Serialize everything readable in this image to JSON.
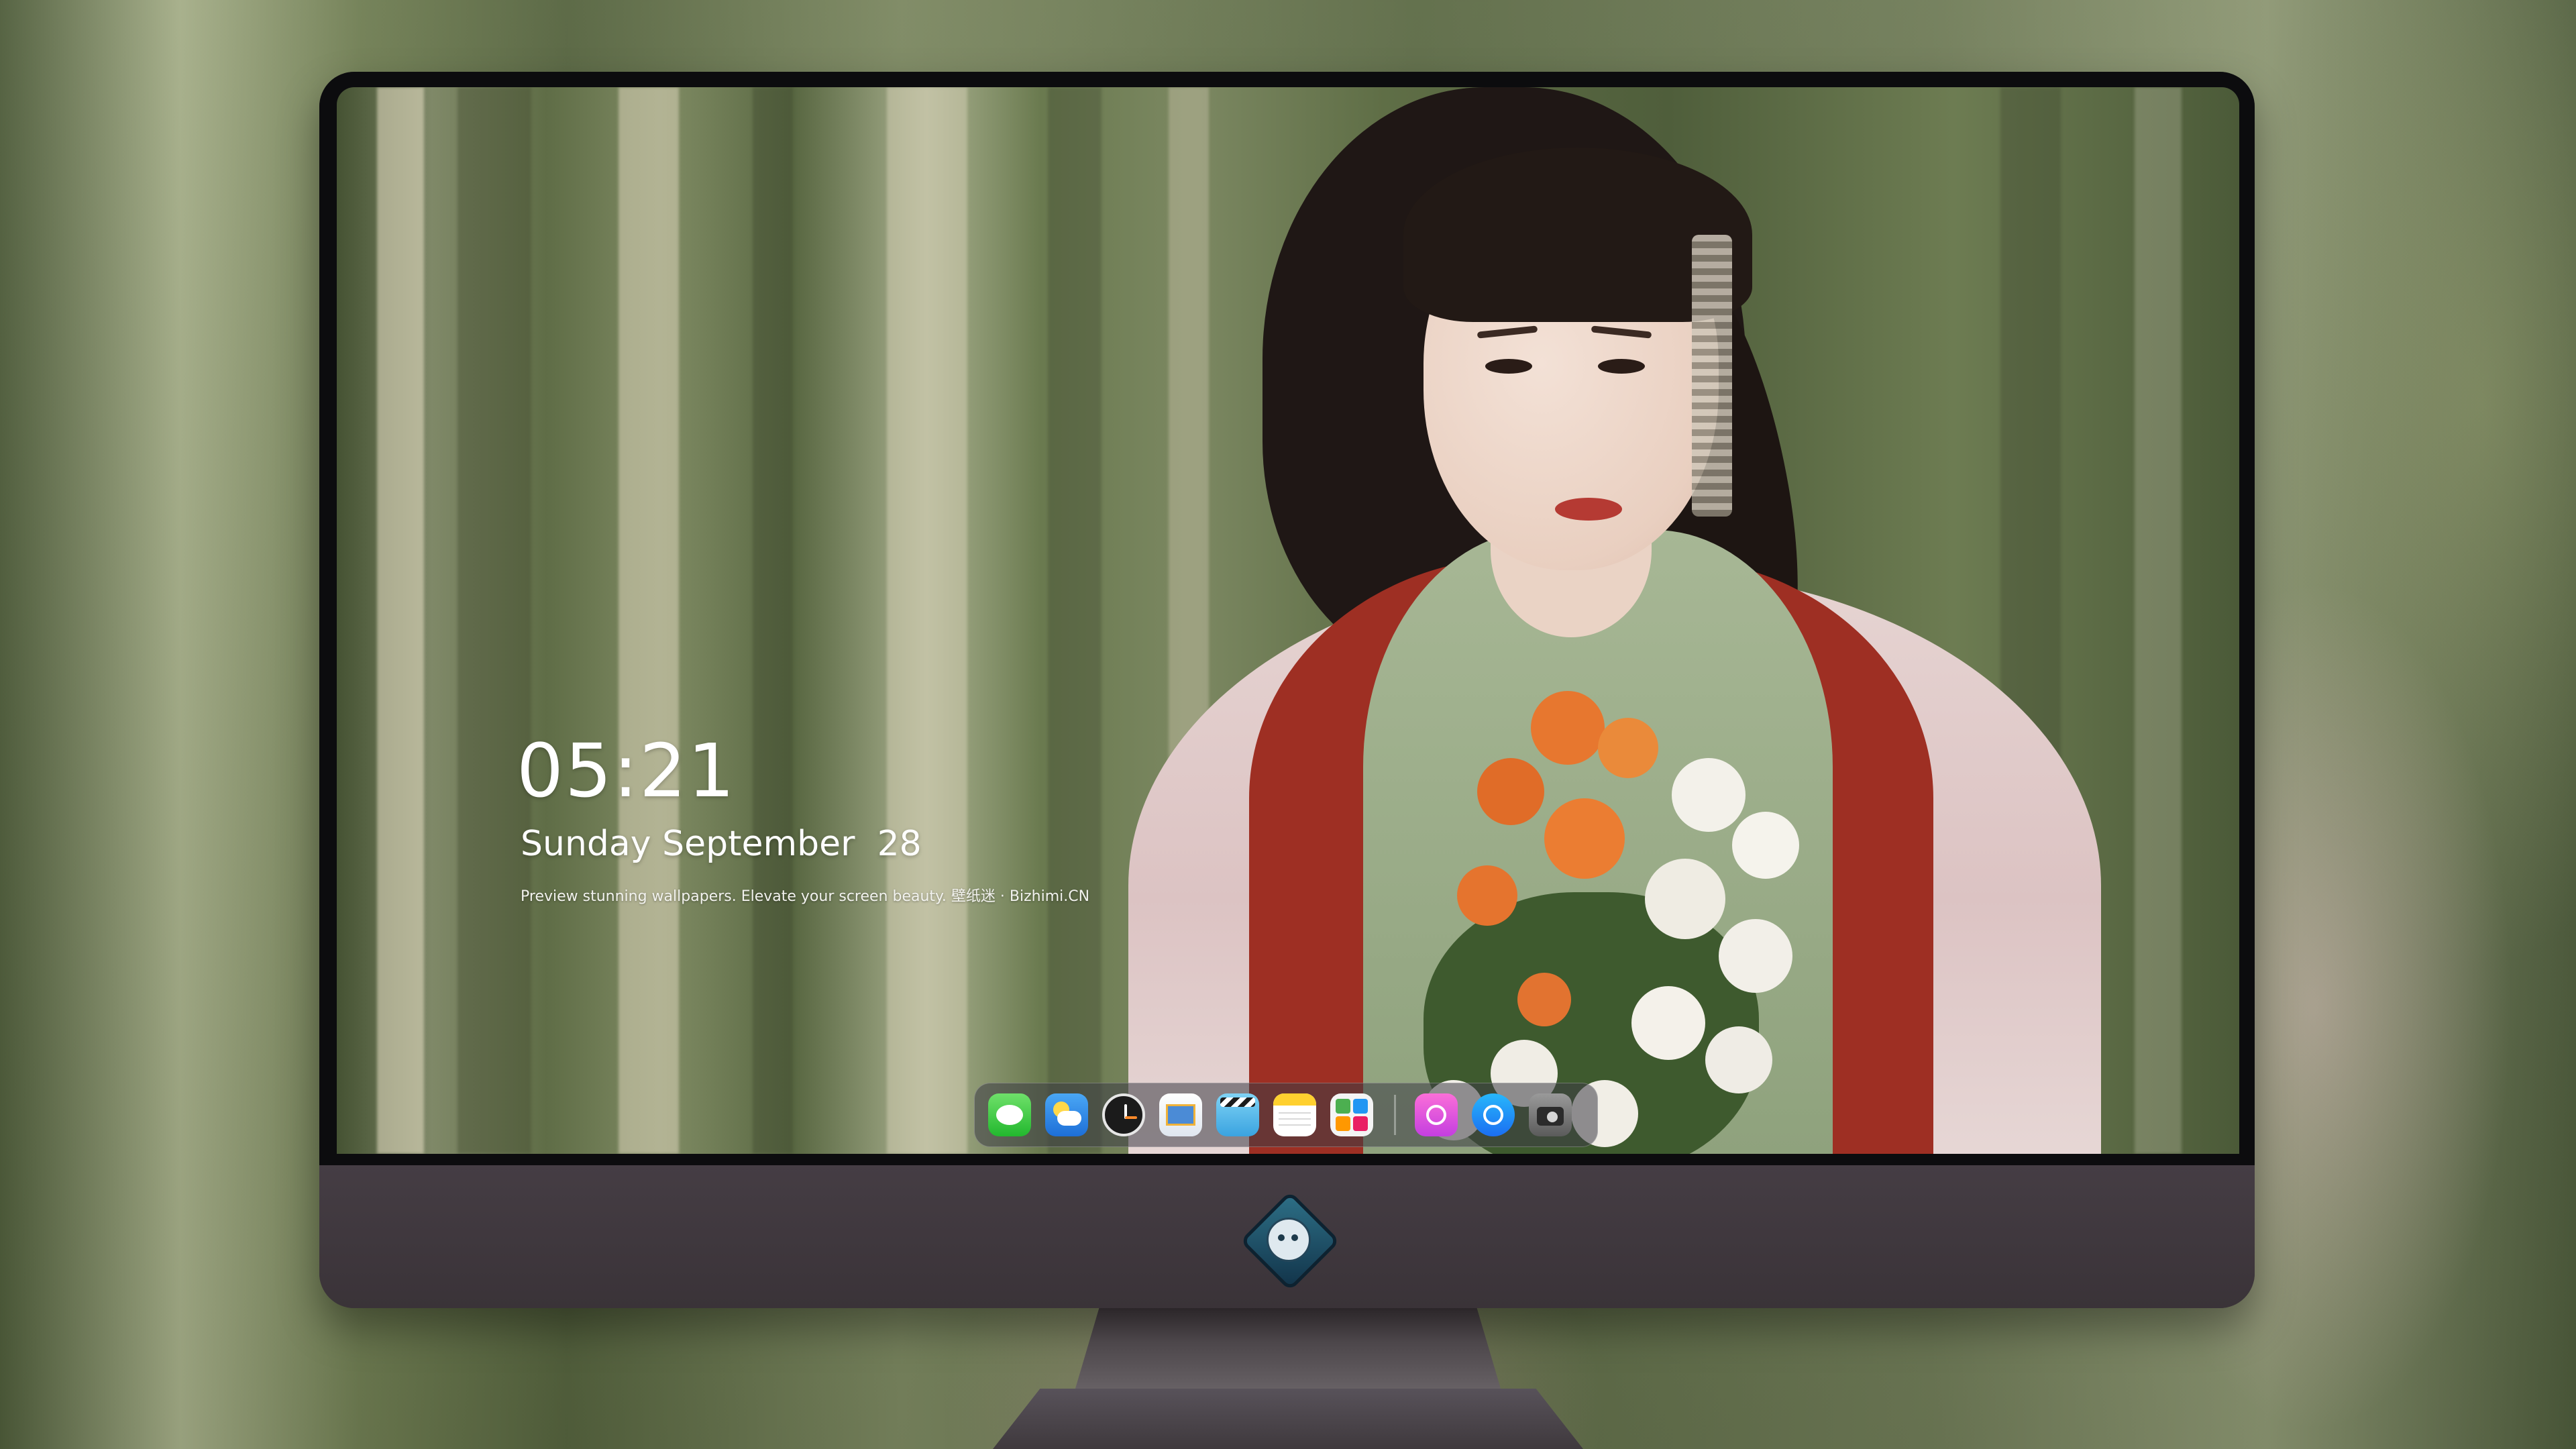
{
  "lockscreen": {
    "time": "05:21",
    "date": "Sunday September  28",
    "tagline": "Preview stunning wallpapers. Elevate your screen beauty. 壁纸迷 · Bizhimi.CN"
  },
  "dock": {
    "apps": [
      {
        "name": "messages-icon"
      },
      {
        "name": "weather-icon"
      },
      {
        "name": "clock-icon"
      },
      {
        "name": "preview-icon"
      },
      {
        "name": "clips-icon"
      },
      {
        "name": "notes-icon"
      },
      {
        "name": "photos-icon"
      },
      {
        "name": "music-icon"
      },
      {
        "name": "app-store-icon"
      },
      {
        "name": "camera-icon"
      }
    ]
  },
  "monitor": {
    "logo": "robot-mascot-logo"
  },
  "colors": {
    "monitor_chin": "#3a3438",
    "bezel": "#0c0c0e",
    "clock_text": "#ffffff"
  }
}
